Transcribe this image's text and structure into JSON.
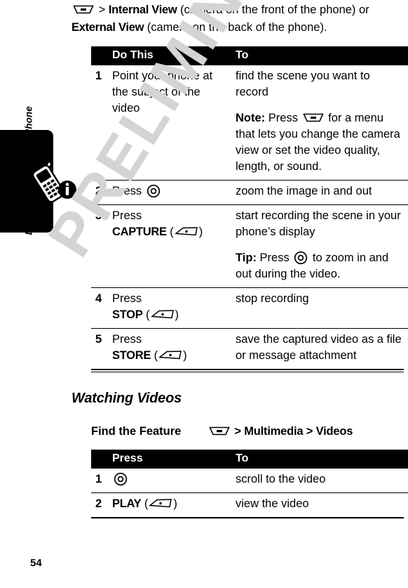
{
  "page": {
    "number": "54",
    "watermark": "PRELIMINARY",
    "sidebar_label": "Learning to Use Your Phone",
    "sidebar_icon": "phone-info-icon"
  },
  "intro": {
    "menu_icon": "menu-key-icon",
    "sep1": ">",
    "cmd1": "Internal View",
    "text1": "(camera on the front of the phone) or",
    "cmd2": "External View",
    "text2": "(camera on the back of the phone)."
  },
  "table_record": {
    "headers": {
      "num": "",
      "do": "Do This",
      "to": "To"
    },
    "rows": [
      {
        "num": "1",
        "action": "Point your phone at the subject of the video",
        "result": "find the scene you want to record",
        "note_label": "Note:",
        "note_pre": "Press",
        "note_icon": "menu-key-icon",
        "note_post": "for a menu that lets you change the camera view or set the video quality, length, or sound."
      },
      {
        "num": "2",
        "action_pre": "Press",
        "action_icon": "nav-key-icon",
        "result": "zoom the image in and out"
      },
      {
        "num": "3",
        "action_pre": "Press",
        "action_cmd": "CAPTURE",
        "action_icon": "softkey-icon",
        "result": "start recording the scene in your phone’s display",
        "note_label": "Tip:",
        "note_pre": "Press",
        "note_icon": "nav-key-icon",
        "note_post": "to zoom in and out during the video."
      },
      {
        "num": "4",
        "action_pre": "Press",
        "action_cmd": "STOP",
        "action_icon": "softkey-icon",
        "result": "stop recording"
      },
      {
        "num": "5",
        "action_pre": "Press",
        "action_cmd": "STORE",
        "action_icon": "softkey-icon",
        "result": "save the captured video as a file or message attachment"
      }
    ]
  },
  "section": {
    "title": "Watching Videos"
  },
  "find_feature": {
    "label": "Find the Feature",
    "icon": "menu-key-icon",
    "path": "> Multimedia > Videos"
  },
  "table_watch": {
    "headers": {
      "num": "",
      "press": "Press",
      "to": "To"
    },
    "rows": [
      {
        "num": "1",
        "action_icon": "nav-key-icon",
        "result": "scroll to the video"
      },
      {
        "num": "2",
        "action_cmd": "PLAY",
        "action_icon": "softkey-icon",
        "result": "view the video"
      }
    ]
  }
}
